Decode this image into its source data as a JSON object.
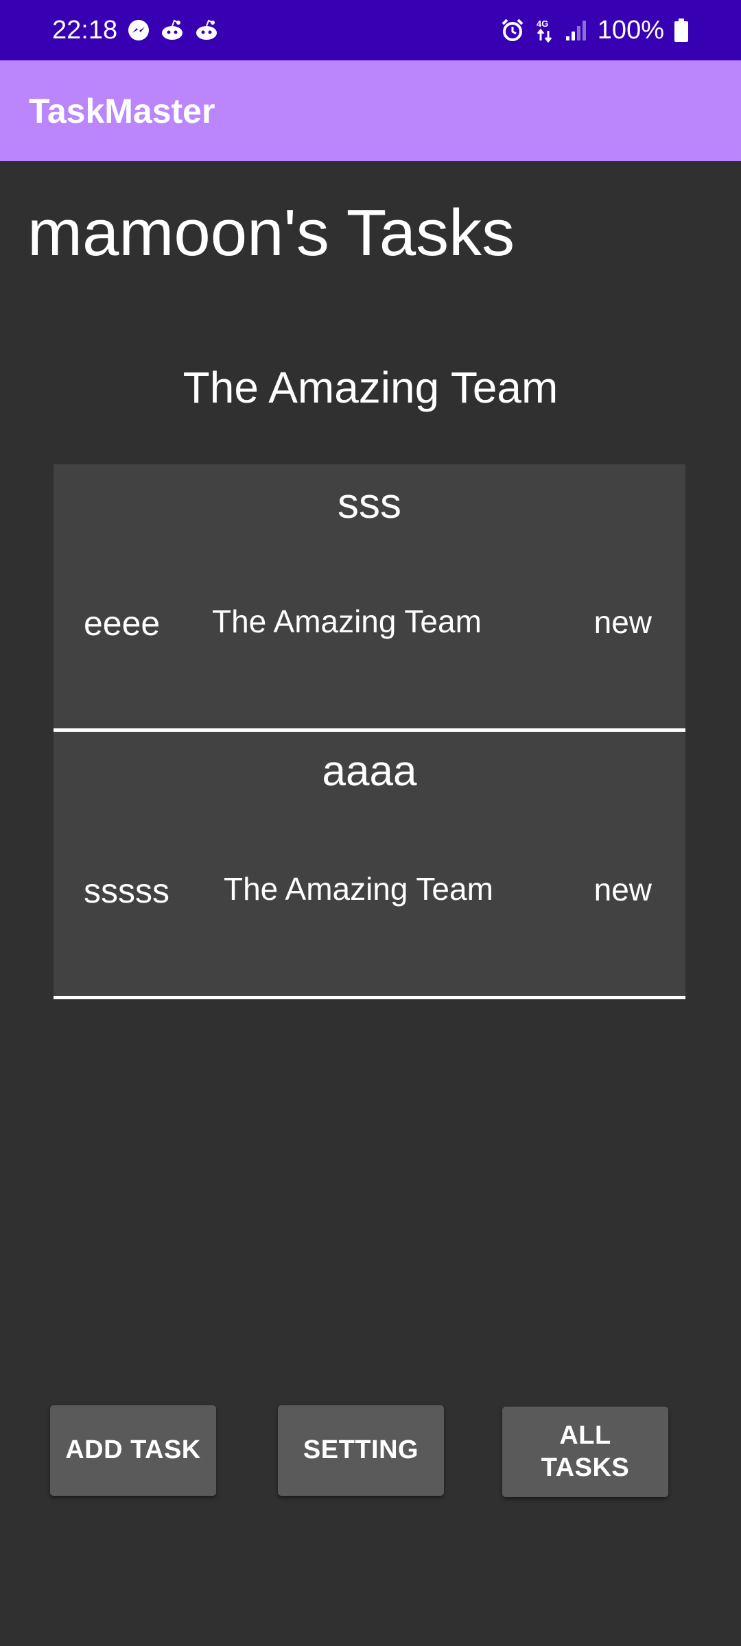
{
  "status_bar": {
    "time": "22:18",
    "left_icons": [
      "messenger-icon",
      "reddit-icon",
      "reddit-icon"
    ],
    "right_icons": [
      "alarm-icon",
      "4g-data-icon",
      "signal-icon"
    ],
    "battery": "100%"
  },
  "app_bar": {
    "title": "TaskMaster",
    "color": "#bb86fc"
  },
  "header": {
    "page_title": "mamoon's Tasks",
    "team_name": "The Amazing Team"
  },
  "tasks": [
    {
      "title": "sss",
      "body": "eeee",
      "team": "The Amazing Team",
      "state": "new"
    },
    {
      "title": "aaaa",
      "body": "sssss",
      "team": "The Amazing Team",
      "state": "new"
    }
  ],
  "buttons": {
    "add_task": "ADD TASK",
    "setting": "SETTING",
    "all_tasks_line1": "ALL",
    "all_tasks_line2": "TASKS"
  },
  "colors": {
    "status_bar": "#3700b3",
    "background": "#303030",
    "card": "#424242",
    "button": "#5a5a5a"
  }
}
